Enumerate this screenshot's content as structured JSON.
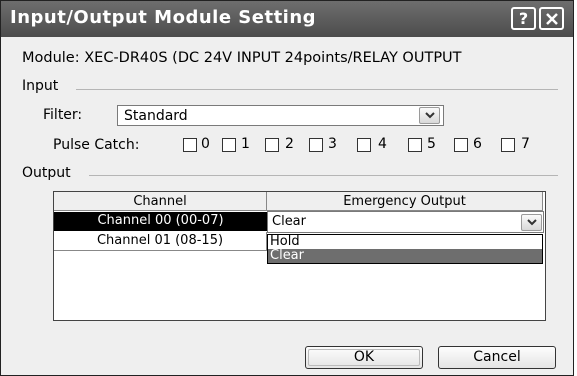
{
  "window": {
    "title": "Input/Output Module Setting",
    "help_label": "?",
    "close_label": "✕"
  },
  "module_line": "Module: XEC-DR40S (DC 24V INPUT 24points/RELAY OUTPUT",
  "input": {
    "group_label": "Input",
    "filter_label": "Filter:",
    "filter_value": "Standard",
    "pulse_catch_label": "Pulse Catch:",
    "pulse_catch_items": [
      "0",
      "1",
      "2",
      "3",
      "4",
      "5",
      "6",
      "7"
    ]
  },
  "output": {
    "group_label": "Output",
    "columns": [
      "Channel",
      "Emergency Output"
    ],
    "rows": [
      {
        "channel": "Channel 00 (00-07)",
        "emergency": "Clear"
      },
      {
        "channel": "Channel 01 (08-15)",
        "emergency": ""
      }
    ],
    "dropdown_options": [
      "Hold",
      "Clear"
    ],
    "dropdown_selected": "Clear"
  },
  "buttons": {
    "ok": "OK",
    "cancel": "Cancel"
  },
  "colors": {
    "titlebar": "#5a5a5a",
    "selected_row": "#000000",
    "selected_option": "#6e6e6e"
  }
}
